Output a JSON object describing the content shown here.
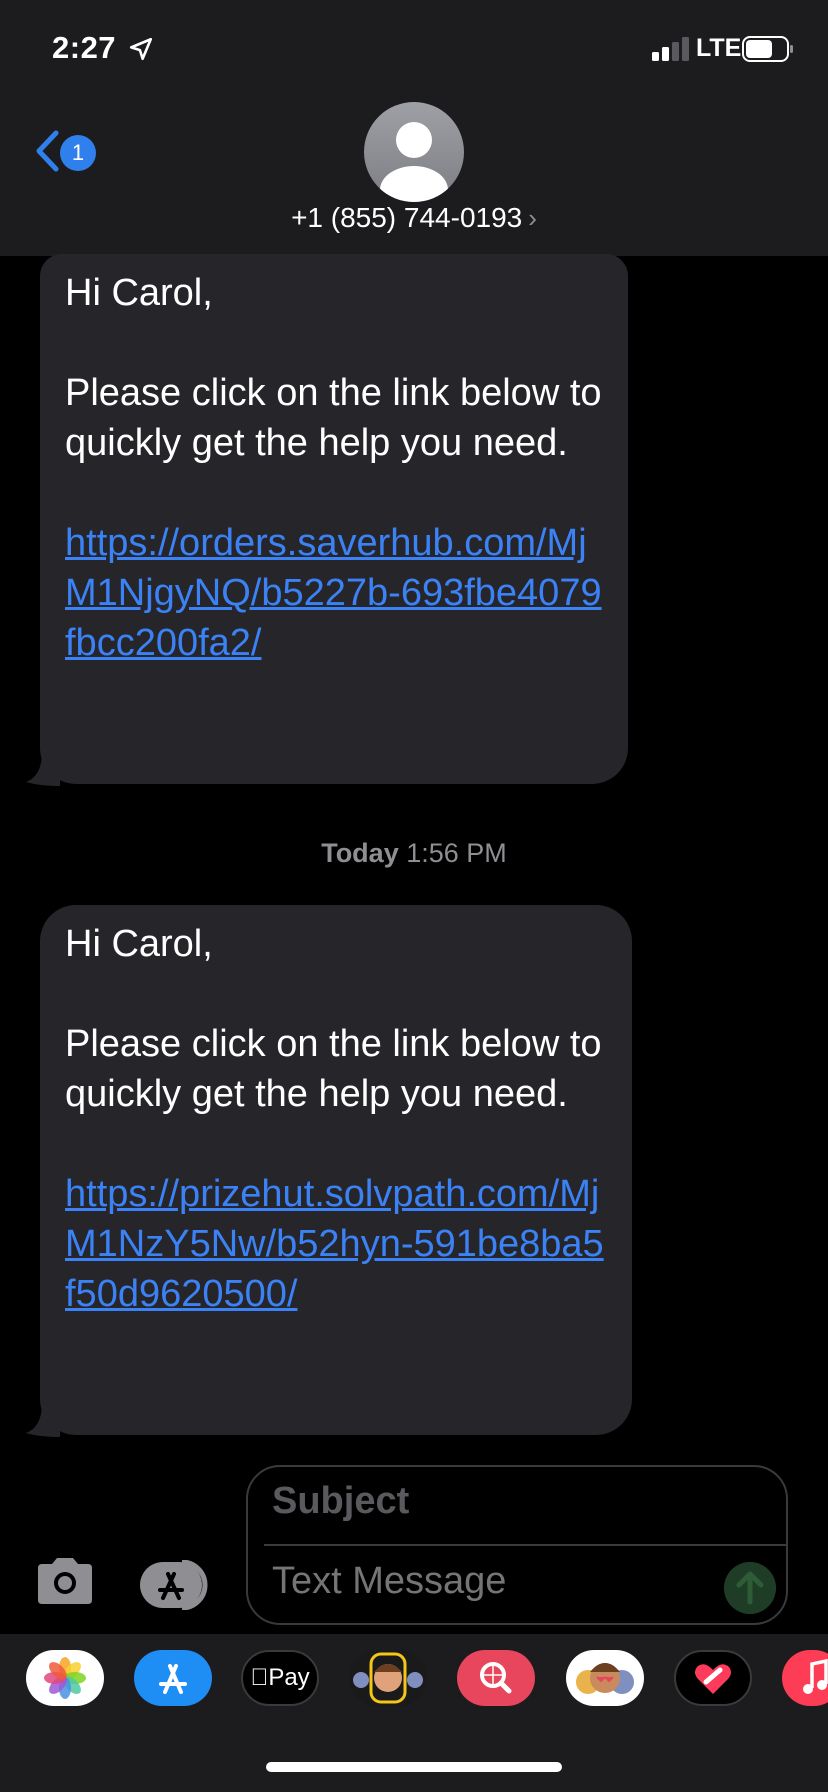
{
  "status_bar": {
    "time": "2:27",
    "network": "LTE"
  },
  "header": {
    "back_badge": "1",
    "contact": "+1 (855) 744-0193"
  },
  "messages": [
    {
      "greeting": "Hi Carol,",
      "body": "Please click on the link below to quickly get the help you need.",
      "link": "https://orders.saverhub.com/MjM1NjgyNQ/b5227b-693fbe4079fbcc200fa2/"
    },
    {
      "greeting": "Hi Carol,",
      "body": "Please click on the link below to quickly get the help you need.",
      "link": "https://prizehut.solvpath.com/MjM1NzY5Nw/b52hyn-591be8ba5f50d9620500/"
    }
  ],
  "timestamp": {
    "day": "Today",
    "time": "1:56 PM"
  },
  "compose": {
    "subject_placeholder": "Subject",
    "message_placeholder": "Text Message"
  },
  "app_drawer": {
    "apple_pay_label": "Pay",
    "apps": [
      "photos-icon",
      "app-store-icon",
      "apple-pay-icon",
      "memoji-stickers-icon",
      "images-search-icon",
      "animoji-icon",
      "digital-touch-icon",
      "music-icon"
    ]
  },
  "colors": {
    "link": "#3b82f6",
    "badge": "#2f80ed",
    "bubble": "#26262a",
    "background": "#000000"
  }
}
